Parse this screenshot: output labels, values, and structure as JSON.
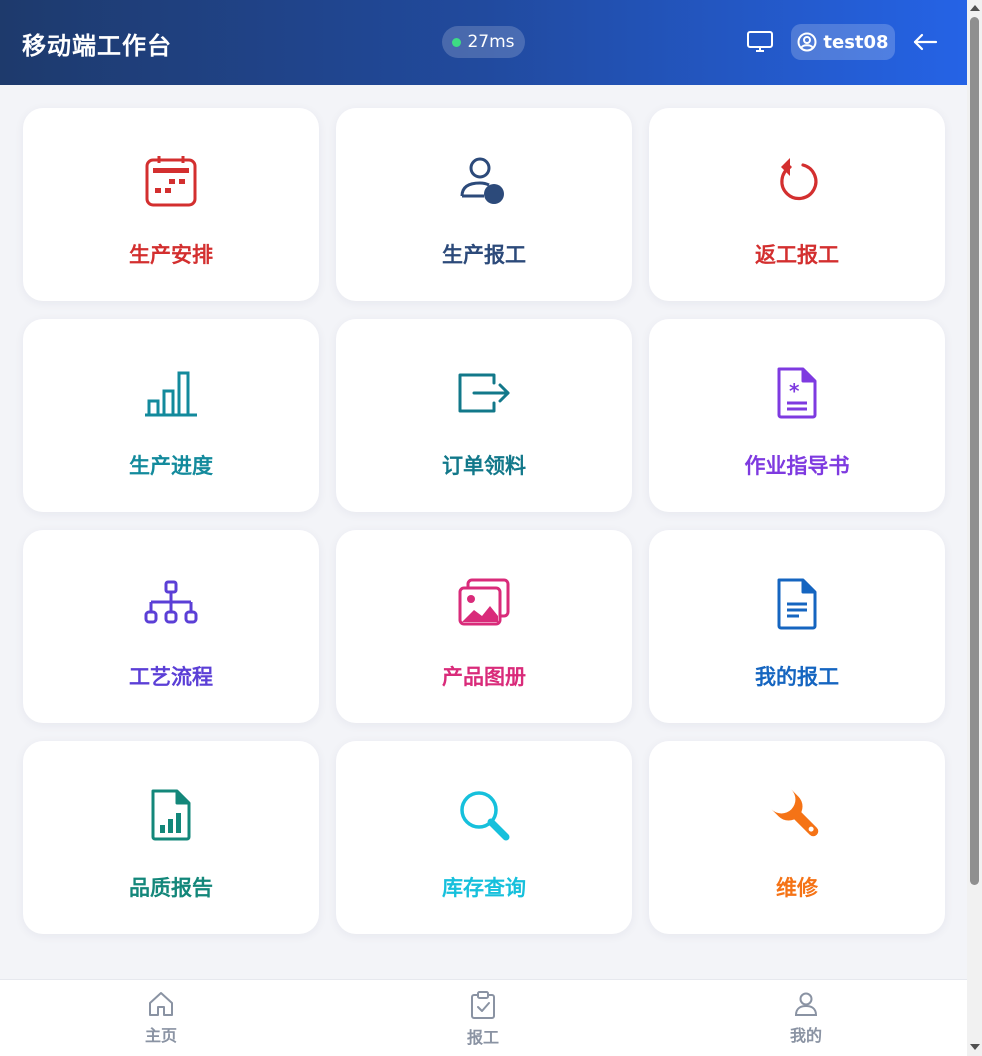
{
  "header": {
    "title": "移动端工作台",
    "latency": "27ms",
    "latency_status_color": "#3ddc84",
    "username": "test08",
    "icons": [
      "monitor-icon",
      "user-circle-icon",
      "arrow-left-icon"
    ]
  },
  "modules": [
    {
      "label": "生产安排",
      "icon": "calendar-icon",
      "color": "#d32f2f"
    },
    {
      "label": "生产报工",
      "icon": "user-report-icon",
      "color": "#2c4a7a"
    },
    {
      "label": "返工报工",
      "icon": "rotate-ccw-icon",
      "color": "#d32f2f"
    },
    {
      "label": "生产进度",
      "icon": "bar-chart-icon",
      "color": "#138a9c"
    },
    {
      "label": "订单领料",
      "icon": "exit-arrow-icon",
      "color": "#12788a"
    },
    {
      "label": "作业指导书",
      "icon": "doc-asterisk-icon",
      "color": "#7e3ae0"
    },
    {
      "label": "工艺流程",
      "icon": "sitemap-icon",
      "color": "#5b3fd6"
    },
    {
      "label": "产品图册",
      "icon": "images-icon",
      "color": "#d92b7a"
    },
    {
      "label": "我的报工",
      "icon": "document-icon",
      "color": "#1565c0"
    },
    {
      "label": "品质报告",
      "icon": "file-chart-icon",
      "color": "#13877a"
    },
    {
      "label": "库存查询",
      "icon": "search-icon",
      "color": "#16c0dc"
    },
    {
      "label": "维修",
      "icon": "wrench-icon",
      "color": "#f57316"
    }
  ],
  "bottom_nav": [
    {
      "label": "主页",
      "icon": "home-icon"
    },
    {
      "label": "报工",
      "icon": "clipboard-check-icon"
    },
    {
      "label": "我的",
      "icon": "user-icon"
    }
  ]
}
